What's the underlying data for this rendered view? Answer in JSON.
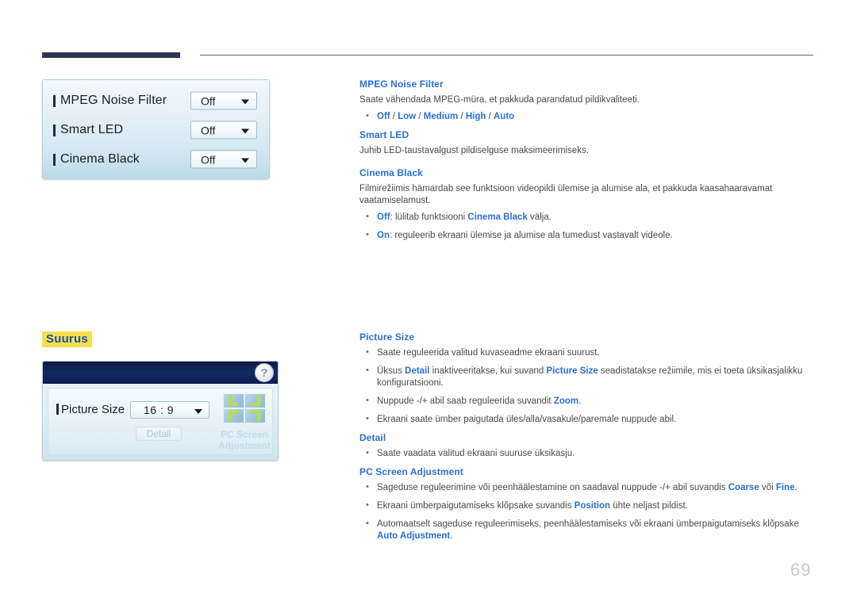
{
  "page": {
    "number": "69"
  },
  "osd_panel_top": {
    "rows": [
      {
        "label": "MPEG Noise Filter",
        "value": "Off"
      },
      {
        "label": "Smart LED",
        "value": "Off"
      },
      {
        "label": "Cinema Black",
        "value": "Off"
      }
    ]
  },
  "size_heading": "Suurus",
  "osd_panel_bottom": {
    "help_label": "?",
    "picture_size_label": "Picture Size",
    "picture_size_value": "16 : 9",
    "detail_button": "Detail",
    "pc_screen_adjustment_label": "PC Screen Adjustment"
  },
  "sections": {
    "mpeg_noise_filter": {
      "heading": "MPEG Noise Filter",
      "body": "Saate vähendada MPEG-müra, et pakkuda parandatud pildikvaliteeti.",
      "options_bullet": {
        "pre": "",
        "options": [
          "Off",
          "Low",
          "Medium",
          "High",
          "Auto"
        ],
        "separator": " / "
      }
    },
    "smart_led": {
      "heading": "Smart LED",
      "body": "Juhib LED-taustavalgust pildiselguse maksimeerimiseks."
    },
    "cinema_black": {
      "heading": "Cinema Black",
      "body": "Filmirežiimis hämardab see funktsioon videopildi ülemise ja alumise ala, et pakkuda kaasahaaravamat vaatamiselamust.",
      "bullet_off": {
        "term": "Off",
        "mid": ": lülitab funktsiooni ",
        "term2": "Cinema Black",
        "tail": " välja."
      },
      "bullet_on": {
        "term": "On",
        "tail": ": reguleerib ekraani ülemise ja alumise ala tumedust vastavalt videole."
      }
    },
    "picture_size": {
      "heading": "Picture Size",
      "b1": "Saate reguleerida valitud kuvaseadme ekraani suurust.",
      "b2": {
        "p1": "Üksus ",
        "t1": "Detail",
        "p2": " inaktiveeritakse, kui suvand ",
        "t2": "Picture Size",
        "p3": " seadistatakse režiimile, mis ei toeta üksikasjalikku konfiguratsiooni."
      },
      "b3": {
        "p1": "Nuppude -/+ abil saab reguleerida suvandit ",
        "t1": "Zoom",
        "p2": "."
      },
      "b4": "Ekraani saate ümber paigutada üles/alla/vasakule/paremale nuppude abil."
    },
    "detail": {
      "heading": "Detail",
      "b1": "Saate vaadata valitud ekraani suuruse üksikasju."
    },
    "pc_screen_adjustment": {
      "heading": "PC Screen Adjustment",
      "b1": {
        "p1": "Sageduse reguleerimine või peenhäälestamine on saadaval nuppude -/+ abil suvandis ",
        "t1": "Coarse",
        "p2": " või ",
        "t2": "Fine",
        "p3": "."
      },
      "b2": {
        "p1": "Ekraani ümberpaigutamiseks klõpsake suvandis ",
        "t1": "Position",
        "p2": " ühte neljast pildist."
      },
      "b3": {
        "p1": "Automaatselt sageduse reguleerimiseks, peenhäälestamiseks või ekraani ümberpaigutamiseks klõpsake ",
        "t1": "Auto Adjustment",
        "p2": "."
      }
    }
  },
  "colors": {
    "accent_blue": "#2b6fd4",
    "rule_navy": "#2e3452",
    "highlight_yellow": "#f5e14e"
  }
}
